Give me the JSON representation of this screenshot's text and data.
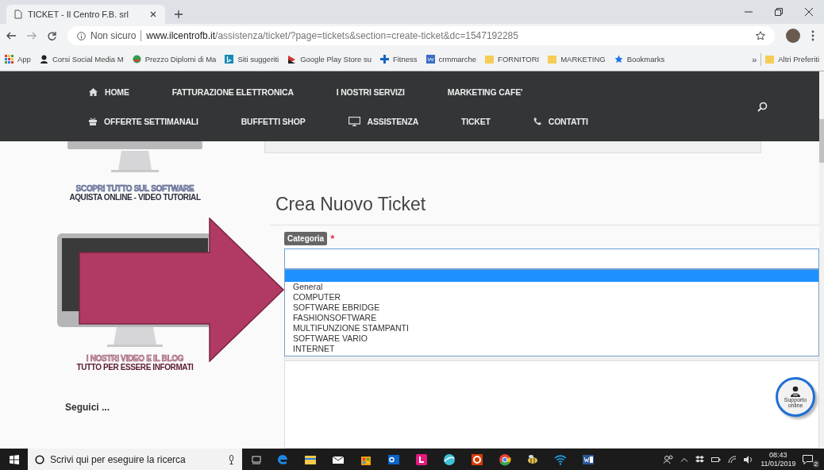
{
  "browser": {
    "tabs": [
      {
        "title": "TICKET - Il Centro F.B. srl",
        "selected": true
      }
    ],
    "address": {
      "security": "Non sicuro",
      "url_host": "www.ilcentrofb.it",
      "url_path": "/assistenza/ticket/?page=tickets&section=create-ticket&dc=1547192285"
    },
    "bookmarks": [
      {
        "label": "App",
        "kind": "apps"
      },
      {
        "label": "Corsi Social Media M",
        "kind": "site"
      },
      {
        "label": "Prezzo Diplomi di Ma",
        "kind": "site2"
      },
      {
        "label": "Siti suggeriti",
        "kind": "bing"
      },
      {
        "label": "Google Play Store su",
        "kind": "play"
      },
      {
        "label": "Fitness",
        "kind": "cross"
      },
      {
        "label": "crmmarche",
        "kind": "wp"
      },
      {
        "label": "FORNITORI",
        "kind": "folder"
      },
      {
        "label": "MARKETING",
        "kind": "folder"
      },
      {
        "label": "Bookmarks",
        "kind": "star"
      }
    ],
    "more_bookmarks": "»",
    "other_bookmarks": "Altri Preferiti"
  },
  "nav": {
    "rows": [
      [
        {
          "label": "HOME",
          "kind": "home"
        },
        {
          "label": "FATTURAZIONE ELETTRONICA",
          "kind": "plain"
        },
        {
          "label": "I NOSTRI SERVIZI",
          "kind": "plain"
        },
        {
          "label": "MARKETING CAFE'",
          "kind": "plain"
        }
      ],
      [
        {
          "label": "OFFERTE SETTIMANALI",
          "kind": "gift"
        },
        {
          "label": "BUFFETTI SHOP",
          "kind": "plain"
        },
        {
          "label": "ASSISTENZA",
          "kind": "monitor"
        },
        {
          "label": "TICKET",
          "kind": "plain"
        },
        {
          "label": "CONTATTI",
          "kind": "phone"
        }
      ]
    ]
  },
  "sidebar": {
    "banners": [
      {
        "line_1": "SCOPRI TUTTO SUL SOFTWARE",
        "line_2": "AQUISTA ONLINE - VIDEO TUTORIAL",
        "kind": "software"
      },
      {
        "line_1": "I NOSTRI VIDEO E IL BLOG",
        "line_2": "TUTTO PER ESSERE INFORMATI",
        "kind": "video"
      }
    ],
    "follow_heading": "Seguici ..."
  },
  "form": {
    "title": "Crea Nuovo Ticket",
    "category_label": "Categoria",
    "required_mark": "*",
    "dropdown": {
      "open": true,
      "blank_option_highlighted": true,
      "options": [
        {
          "label": "General",
          "selected": false
        },
        {
          "label": "COMPUTER",
          "selected": false
        },
        {
          "label": "SOFTWARE EBRIDGE",
          "selected": false
        },
        {
          "label": "FASHIONSOFTWARE",
          "selected": false
        },
        {
          "label": "MULTIFUNZIONE STAMPANTI",
          "selected": false
        },
        {
          "label": "SOFTWARE VARIO",
          "selected": false
        },
        {
          "label": "INTERNET",
          "selected": false
        }
      ]
    }
  },
  "support_button": {
    "label": "Supporto online"
  },
  "taskbar": {
    "search_placeholder": "Scrivi qui per eseguire la ricerca",
    "time": "08:43",
    "date": "11/01/2019",
    "notifications": "2",
    "apps": [
      {
        "kind": "edge"
      },
      {
        "kind": "folder"
      },
      {
        "kind": "mail"
      },
      {
        "kind": "store"
      },
      {
        "kind": "outlook"
      },
      {
        "kind": "square"
      },
      {
        "kind": "round"
      },
      {
        "kind": "letter"
      },
      {
        "kind": "chrome"
      },
      {
        "kind": "bee"
      },
      {
        "kind": "wifi"
      },
      {
        "kind": "word"
      }
    ]
  }
}
